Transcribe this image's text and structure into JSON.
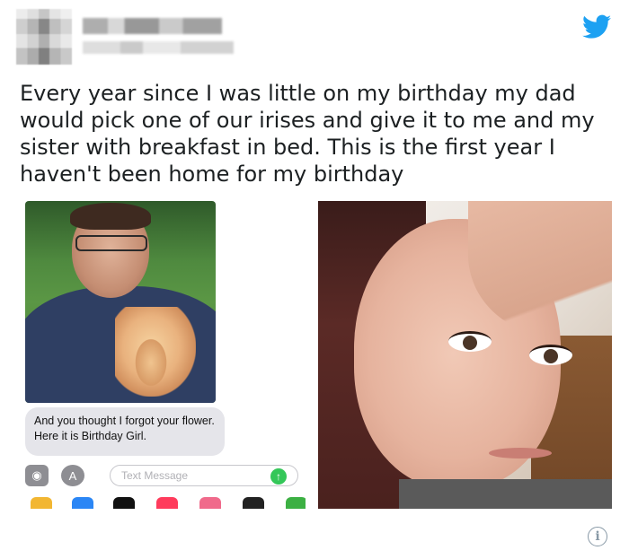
{
  "tweet": {
    "text": "Every year since I was little on my birthday my dad would pick one of our irises and give it to me and my sister with breakfast in bed. This is the first year I haven't been home for my birthday"
  },
  "imessage": {
    "bubble_text": "And you thought I forgot your flower. Here it is Birthday Girl.",
    "input_placeholder": "Text Message"
  },
  "colors": {
    "twitter_blue": "#1da1f2",
    "bubble_gray": "#e5e5ea",
    "send_green": "#34c759",
    "text": "#1c2022"
  },
  "icons": [
    "twitter-bird-icon",
    "camera-icon",
    "app-store-icon",
    "send-arrow-icon",
    "info-icon"
  ]
}
